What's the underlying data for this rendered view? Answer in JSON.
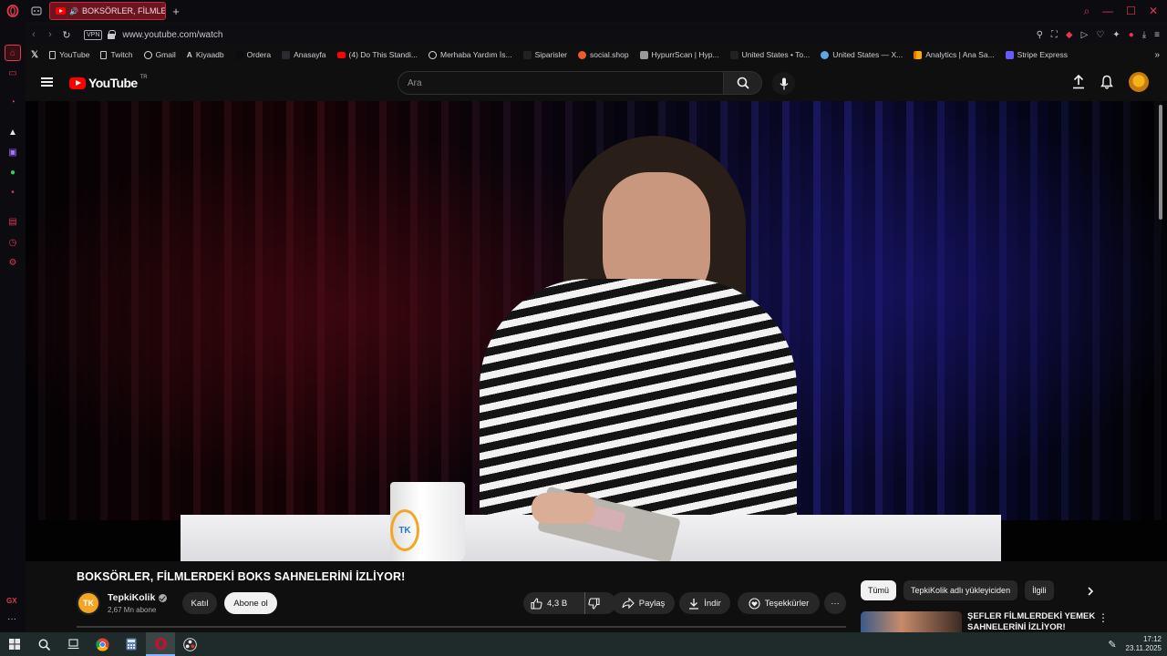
{
  "browser": {
    "tab": {
      "title": "BOKSÖRLER, FİLMLERDEKİ BOKS SAHNELERİNİ İZLİYOR!"
    },
    "new_tab": "+",
    "vpn_label": "VPN",
    "url": "www.youtube.com/watch",
    "bookmarks": [
      {
        "label": "YouTube",
        "color": "#ff0000"
      },
      {
        "label": "Twitch",
        "color": "#a970ff"
      },
      {
        "label": "Gmail",
        "color": "#ffffff"
      },
      {
        "label": "Kiyaadb",
        "color": "#ffffff"
      },
      {
        "label": "Ordera",
        "color": "#0b0b10"
      },
      {
        "label": "Anasayfa",
        "color": "#444444"
      },
      {
        "label": "(4) Do This Standi...",
        "color": "#ff0000"
      },
      {
        "label": "Merhaba Yardım İs...",
        "color": "#dddddd"
      },
      {
        "label": "Siparisler",
        "color": "#333333"
      },
      {
        "label": "social.shop",
        "color": "#ef5a2a"
      },
      {
        "label": "HypurrScan | Hyp...",
        "color": "#bbbbbb"
      },
      {
        "label": "United States • To...",
        "color": "#333333"
      },
      {
        "label": "United States — X...",
        "color": "#5aa9e6"
      },
      {
        "label": "Analytics | Ana Sa...",
        "color": "#f9ab00"
      },
      {
        "label": "Stripe Express",
        "color": "#635bff"
      }
    ]
  },
  "youtube": {
    "logo_text": "YouTube",
    "logo_country": "TR",
    "search_placeholder": "Ara",
    "video": {
      "title": "BOKSÖRLER, FİLMLERDEKİ BOKS SAHNELERİNİ İZLİYOR!",
      "channel": "TepkiKolik",
      "channel_initials": "TK",
      "subscribers": "2,67 Mn abone",
      "join_label": "Katıl",
      "subscribe_label": "Abone ol",
      "likes": "4,3 B",
      "share_label": "Paylaş",
      "download_label": "İndir",
      "thanks_label": "Teşekkürler",
      "more_label": "···"
    },
    "mug_logo": "TK",
    "chips": [
      "Tümü",
      "TepkiKolik adlı yükleyiciden",
      "İlgili"
    ],
    "recommendation": {
      "title": "ŞEFLER FİLMLERDEKİ YEMEK SAHNELERİNİ İZLİYOR!"
    }
  },
  "sidebar": {
    "gx_label": "GX"
  },
  "taskbar": {
    "time": "17:12",
    "date": "23.11.2025"
  }
}
